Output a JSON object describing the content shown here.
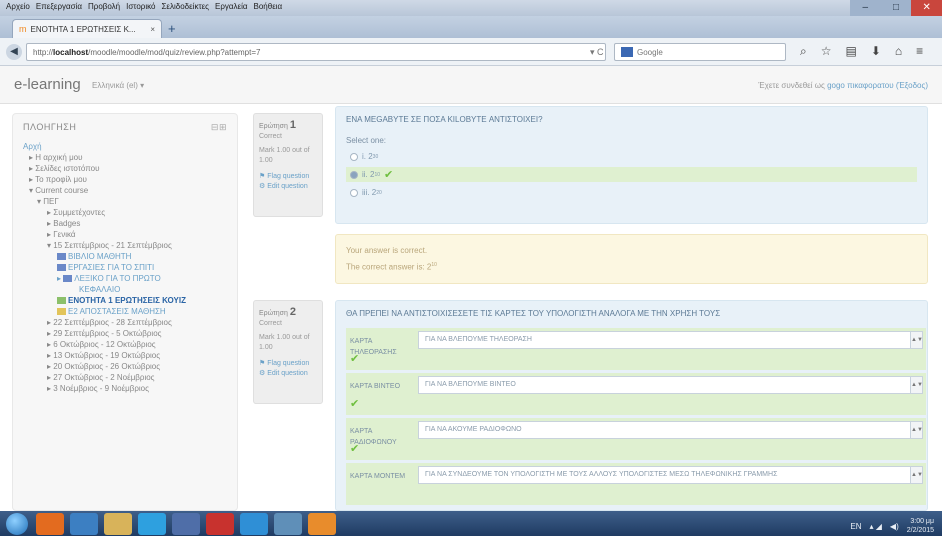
{
  "browser": {
    "menus": [
      "Αρχείο",
      "Επεξεργασία",
      "Προβολή",
      "Ιστορικό",
      "Σελιδοδείκτες",
      "Εργαλεία",
      "Βοήθεια"
    ],
    "tab_title": "ΕΝΟΤΗΤΑ 1 ΕΡΩΤΗΣΕΙΣ Κ...",
    "url_prefix": "http://",
    "url_host": "localhost",
    "url_path": "/moodle/moodle/mod/quiz/review.php?attempt=7",
    "search_placeholder": "Google"
  },
  "header": {
    "brand": "e-learning",
    "language": "Ελληνικά (el) ▾",
    "login_text": "Έχετε συνδεθεί ως",
    "login_user": "gogo πικαφορατου (Έξοδος)"
  },
  "sidebar": {
    "title": "ΠΛΟΗΓΗΣΗ",
    "items": [
      "Αρχή",
      "Η αρχική μου",
      "Σελίδες ιστοτόπου",
      "Το προφίλ μου",
      "Current course",
      "ΠΕΓ",
      "Συμμετέχοντες",
      "Badges",
      "Γενικά",
      "15 Σεπτέμβριος - 21 Σεπτέμβριος",
      "ΒΙΒΛΙΟ ΜΑΘΗΤΗ",
      "ΕΡΓΑΣΙΕΣ ΓΙΑ ΤΟ ΣΠΙΤΙ",
      "ΛΕΞΙΚΟ ΓΙΑ ΤΟ ΠΡΩΤΟ",
      "ΚΕΦΑΛΑΙΟ",
      "ΕΝΟΤΗΤΑ 1 ΕΡΩΤΗΣΕΙΣ ΚΟΥΙΖ",
      "Ε2 ΑΠΟΣΤΑΣΕΙΣ ΜΑΘΗΣΗ",
      "22 Σεπτέμβριος - 28 Σεπτέμβριος",
      "29 Σεπτέμβριος - 5 Οκτώβριος",
      "6 Οκτώβριος - 12 Οκτώβριος",
      "13 Οκτώβριος - 19 Οκτώβριος",
      "20 Οκτώβριος - 26 Οκτώβριος",
      "27 Οκτώβριος - 2 Νοέμβριος",
      "3 Νοέμβριος - 9 Νοέμβριος"
    ]
  },
  "q1": {
    "label": "Ερώτηση",
    "number": "1",
    "status": "Correct",
    "mark": "Mark 1.00 out of 1.00",
    "flag": "Flag question",
    "edit": "Edit question",
    "text": "ΕΝΑ ΜΕGABYTE ΣΕ ΠΟΣΑ KILOBYTE ΑΝΤΙΣΤΟΙΧΕΙ?",
    "prompt": "Select one:",
    "options": [
      {
        "prefix": "i. 2",
        "sup": "30"
      },
      {
        "prefix": "ii. 2",
        "sup": "10"
      },
      {
        "prefix": "iii. 2",
        "sup": "20"
      }
    ],
    "feedback": "Your answer is correct.",
    "correct_answer_prefix": "The correct answer is: 2",
    "correct_answer_sup": "10"
  },
  "q2": {
    "label": "Ερώτηση",
    "number": "2",
    "status": "Correct",
    "mark": "Mark 1.00 out of 1.00",
    "flag": "Flag question",
    "edit": "Edit question",
    "text": "ΘΑ ΠΡΕΠΕΙ ΝΑ ΑΝΤΙΣΤΟΙΧΙΣΕΣΕΤΕ ΤΙΣ ΚΑΡΤΕΣ ΤΟΥ ΥΠΟΛΟΓΙΣΤΗ ΑΝΑΛΟΓΑ ΜΕ ΤΗΝ ΧΡΗΣΗ ΤΟΥΣ",
    "rows": [
      {
        "label": "ΚΑΡΤΑ ΤΗΛΕΟΡΑΣΗΣ",
        "value": "ΓΙΑ ΝΑ ΒΛΕΠΟΥΜΕ ΤΗΛΕΟΡΑΣΗ"
      },
      {
        "label": "ΚΑΡΤΑ ΒΙΝΤΕΟ",
        "value": "ΓΙΑ ΝΑ ΒΛΕΠΟΥΜΕ ΒΙΝΤΕΟ"
      },
      {
        "label": "ΚΑΡΤΑ ΡΑΔΙΟΦΩΝΟΥ",
        "value": "ΓΙΑ ΝΑ ΑΚΟΥΜΕ ΡΑΔΙΟΦΩΝΟ"
      },
      {
        "label": "ΚΑΡΤΑ ΜΟΝΤΕΜ",
        "value": "ΓΙΑ ΝΑ ΣΥΝΔΕΟΥΜΕ ΤΟΝ ΥΠΟΛΟΓΙΣΤΗ ΜΕ ΤΟΥΣ ΑΛΛΟΥΣ ΥΠΟΛΟΓΙΣΤΕΣ ΜΕΣΩ ΤΗΛΕΦΩΝΙΚΗΣ ΓΡΑΜΜΗΣ"
      }
    ]
  },
  "tray": {
    "lang": "EN",
    "time": "3:00 μμ",
    "date": "2/2/2015"
  }
}
